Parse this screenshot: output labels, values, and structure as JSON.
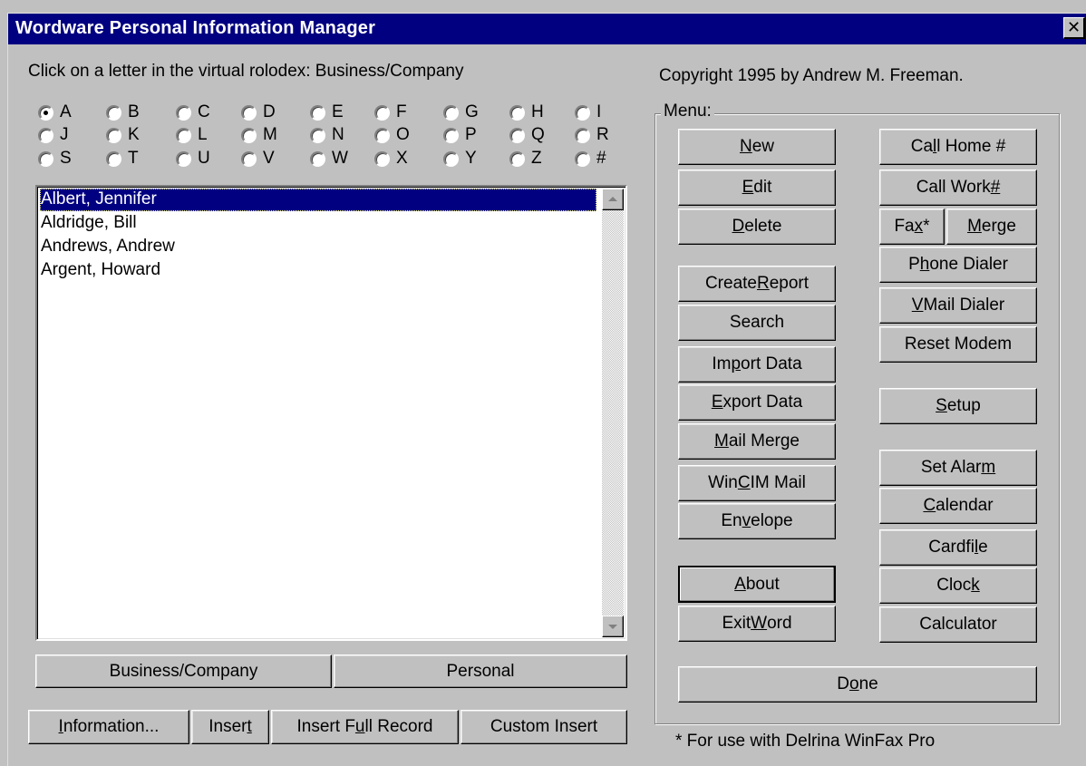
{
  "window": {
    "title": "Wordware Personal Information Manager",
    "close_glyph": "✕"
  },
  "instruction": "Click on a letter in the virtual rolodex: Business/Company",
  "copyright": "Copyright 1995 by Andrew M. Freeman.",
  "rolodex": {
    "selected": "A",
    "letters": [
      "A",
      "B",
      "C",
      "D",
      "E",
      "F",
      "G",
      "H",
      "I",
      "J",
      "K",
      "L",
      "M",
      "N",
      "O",
      "P",
      "Q",
      "R",
      "S",
      "T",
      "U",
      "V",
      "W",
      "X",
      "Y",
      "Z",
      "#"
    ]
  },
  "contacts": {
    "items": [
      "Albert, Jennifer",
      "Aldridge, Bill",
      "Andrews, Andrew",
      "Argent, Howard"
    ],
    "selected_index": 0
  },
  "category_buttons": {
    "business": "Business/Company",
    "personal": "Personal"
  },
  "bottom_buttons": {
    "information": {
      "pre": "",
      "ul": "I",
      "post": "nformation..."
    },
    "insert": {
      "pre": "Inser",
      "ul": "t",
      "post": ""
    },
    "insert_full": {
      "pre": "Insert F",
      "ul": "u",
      "post": "ll Record"
    },
    "custom_insert": {
      "pre": "Custom Insert",
      "ul": "",
      "post": ""
    }
  },
  "menu": {
    "caption": "Menu:",
    "new": {
      "pre": "",
      "ul": "N",
      "post": "ew"
    },
    "edit": {
      "pre": "",
      "ul": "E",
      "post": "dit"
    },
    "delete": {
      "pre": "",
      "ul": "D",
      "post": "elete"
    },
    "create_report": {
      "pre": "Create ",
      "ul": "R",
      "post": "eport"
    },
    "search": {
      "pre": "Search",
      "ul": "",
      "post": ""
    },
    "import_data": {
      "pre": "Im",
      "ul": "p",
      "post": "ort Data"
    },
    "export_data": {
      "pre": "",
      "ul": "E",
      "post": "xport Data"
    },
    "mail_merge": {
      "pre": "",
      "ul": "M",
      "post": "ail Merge"
    },
    "wincim_mail": {
      "pre": "Win",
      "ul": "C",
      "post": "IM Mail"
    },
    "envelope": {
      "pre": "En",
      "ul": "v",
      "post": "elope"
    },
    "about": {
      "pre": "",
      "ul": "A",
      "post": "bout"
    },
    "exit_word": {
      "pre": "Exit ",
      "ul": "W",
      "post": "ord"
    },
    "call_home": {
      "pre": "Ca",
      "ul": "l",
      "post": "l Home #"
    },
    "call_work": {
      "pre": "Call Work ",
      "ul": "#",
      "post": ""
    },
    "fax": {
      "pre": "Fa",
      "ul": "x",
      "post": "*"
    },
    "merge": {
      "pre": "",
      "ul": "M",
      "post": "erge"
    },
    "phone_dialer": {
      "pre": "P",
      "ul": "h",
      "post": "one Dialer"
    },
    "vmail_dialer": {
      "pre": "",
      "ul": "V",
      "post": "Mail Dialer"
    },
    "reset_modem": {
      "pre": "Reset Modem",
      "ul": "",
      "post": ""
    },
    "setup": {
      "pre": "",
      "ul": "S",
      "post": "etup"
    },
    "set_alarm": {
      "pre": "Set Alar",
      "ul": "m",
      "post": ""
    },
    "calendar": {
      "pre": "",
      "ul": "C",
      "post": "alendar"
    },
    "cardfile": {
      "pre": "Cardfi",
      "ul": "l",
      "post": "e"
    },
    "clock": {
      "pre": "Cloc",
      "ul": "k",
      "post": ""
    },
    "calculator": {
      "pre": "Calculator",
      "ul": "",
      "post": ""
    },
    "done": {
      "pre": "D",
      "ul": "o",
      "post": "ne"
    }
  },
  "footnote": "* For use with Delrina WinFax Pro"
}
